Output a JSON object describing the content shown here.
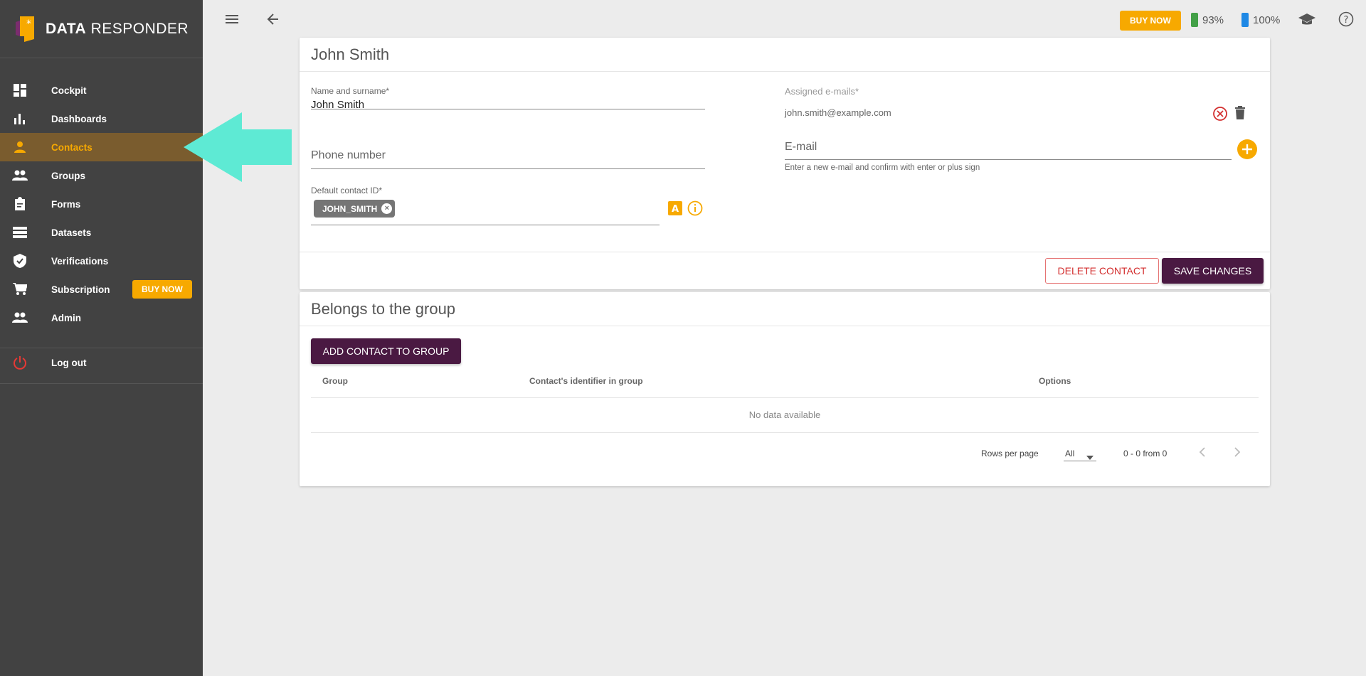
{
  "brand": {
    "name_bold": "DATA",
    "name_rest": "RESPONDER"
  },
  "sidebar": {
    "items": [
      {
        "label": "Cockpit",
        "icon": "dashboard-icon"
      },
      {
        "label": "Dashboards",
        "icon": "bar-chart-icon"
      },
      {
        "label": "Contacts",
        "icon": "person-icon",
        "active": true
      },
      {
        "label": "Groups",
        "icon": "people-icon"
      },
      {
        "label": "Forms",
        "icon": "clipboard-icon"
      },
      {
        "label": "Datasets",
        "icon": "list-icon"
      },
      {
        "label": "Verifications",
        "icon": "shield-check-icon"
      },
      {
        "label": "Subscription",
        "icon": "cart-icon",
        "badge": "BUY NOW"
      },
      {
        "label": "Admin",
        "icon": "people-icon"
      }
    ],
    "logout": "Log out"
  },
  "topbar": {
    "buy_now": "BUY NOW",
    "stat_green": "93%",
    "stat_blue": "100%"
  },
  "contact": {
    "title": "John Smith",
    "name_label": "Name and surname*",
    "name_value": "John Smith",
    "phone_placeholder": "Phone number",
    "default_id_label": "Default contact ID*",
    "default_id_chip": "JOHN_SMITH",
    "emails_label": "Assigned e-mails*",
    "email_assigned": "john.smith@example.com",
    "email_placeholder": "E-mail",
    "email_hint": "Enter a new e-mail and confirm with enter or plus sign",
    "delete_label": "DELETE CONTACT",
    "save_label": "SAVE CHANGES"
  },
  "groups": {
    "title": "Belongs to the group",
    "add_label": "ADD CONTACT TO GROUP",
    "columns": [
      "Group",
      "Contact's identifier in group",
      "Options"
    ],
    "empty": "No data available",
    "rows_per_page_label": "Rows per page",
    "rows_per_page_value": "All",
    "range": "0 - 0 from 0"
  },
  "colors": {
    "accent": "#f7a900",
    "primary": "#4a1942",
    "sidebar": "#424242",
    "arrow": "#5eead4"
  }
}
